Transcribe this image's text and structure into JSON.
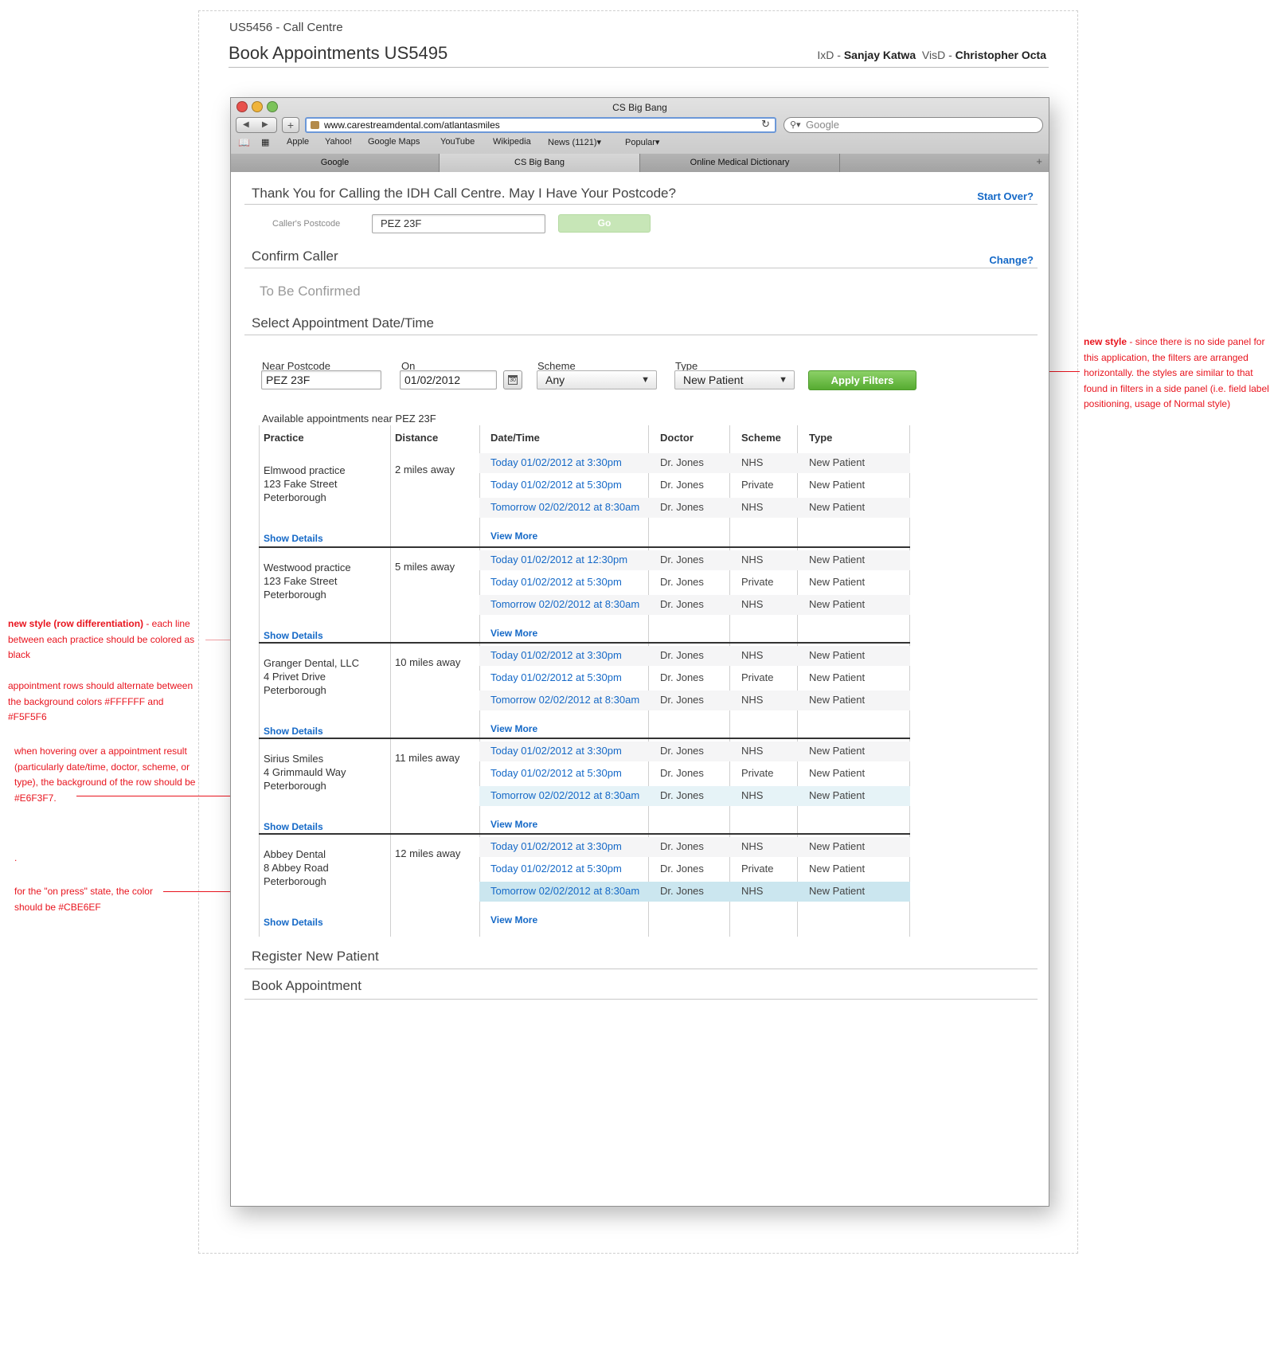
{
  "spec": {
    "project": "US5456 - Call Centre",
    "title": "Book Appointments US5495",
    "ixd_label": "IxD - ",
    "ixd_name": "Sanjay Katwa",
    "visd_label": "VisD - ",
    "visd_name": "Christopher Octa"
  },
  "notes": {
    "filters_bold": "new style",
    "filters_text": " - since there is no side panel for this application, the filters are arranged horizontally. the styles are similar to that found in filters in a side panel (i.e. field label positioning, usage of Normal style)",
    "rows_bold": "new style (row differentiation)",
    "rows_text": " - each line between each practice should be colored as black",
    "alternate_text": "appointment rows should alternate between the background colors #FFFFFF and #F5F5F6",
    "hover_text": "when hovering over a appointment result (particularly date/time, doctor, scheme, or type), the background of the row should be #E6F3F7.",
    "dot_text": ".",
    "press_text": "for the \"on press\" state, the color should be #CBE6EF"
  },
  "colors": {
    "link": "#1569c7",
    "annotation": "#e8141e",
    "row_alt": "#F5F5F6",
    "row_hover": "#E6F3F7",
    "row_press": "#CBE6EF",
    "apply_button": "#6abb43"
  },
  "browser": {
    "window_title": "CS Big Bang",
    "url": "www.carestreamdental.com/atlantasmiles",
    "search_placeholder": "Google",
    "bookmarks": [
      "Apple",
      "Yahoo!",
      "Google Maps",
      "YouTube",
      "Wikipedia",
      "News (1121)▾",
      "Popular▾"
    ],
    "tabs": [
      "Google",
      "CS Big Bang",
      "Online Medical Dictionary"
    ],
    "icons": [
      "back-arrow-icon",
      "forward-arrow-icon",
      "add-icon",
      "reload-icon",
      "search-icon",
      "bookmarks-book-icon",
      "top-sites-grid-icon",
      "new-tab-icon"
    ]
  },
  "postcode_section": {
    "title": "Thank You for Calling the IDH Call Centre. May I Have Your Postcode?",
    "start_over": "Start Over?",
    "label": "Caller's Postcode",
    "value": "PEZ 23F",
    "go": "Go"
  },
  "confirm_section": {
    "title": "Confirm Caller",
    "change": "Change?",
    "status": "To Be Confirmed"
  },
  "select_section": {
    "title": "Select Appointment Date/Time",
    "filters": {
      "near_label": "Near Postcode",
      "near_value": "PEZ 23F",
      "on_label": "On",
      "on_value": "01/02/2012",
      "scheme_label": "Scheme",
      "scheme_value": "Any",
      "type_label": "Type",
      "type_value": "New Patient",
      "apply": "Apply Filters",
      "calendar_glyph": "30"
    },
    "available": "Available appointments near PEZ 23F",
    "columns": [
      "Practice",
      "Distance",
      "Date/Time",
      "Doctor",
      "Scheme",
      "Type"
    ],
    "show_details": "Show Details",
    "view_more": "View More",
    "practices": [
      {
        "name": "Elmwood practice",
        "street": "123 Fake Street",
        "town": "Peterborough",
        "distance": "2 miles away",
        "appointments": [
          {
            "datetime": "Today 01/02/2012 at 3:30pm",
            "doctor": "Dr. Jones",
            "scheme": "NHS",
            "type": "New Patient"
          },
          {
            "datetime": "Today 01/02/2012 at 5:30pm",
            "doctor": "Dr. Jones",
            "scheme": "Private",
            "type": "New Patient"
          },
          {
            "datetime": "Tomorrow 02/02/2012 at 8:30am",
            "doctor": "Dr. Jones",
            "scheme": "NHS",
            "type": "New Patient"
          }
        ]
      },
      {
        "name": "Westwood practice",
        "street": "123 Fake Street",
        "town": "Peterborough",
        "distance": "5 miles away",
        "appointments": [
          {
            "datetime": "Today 01/02/2012 at 12:30pm",
            "doctor": "Dr. Jones",
            "scheme": "NHS",
            "type": "New Patient"
          },
          {
            "datetime": "Today 01/02/2012 at 5:30pm",
            "doctor": "Dr. Jones",
            "scheme": "Private",
            "type": "New Patient"
          },
          {
            "datetime": "Tomorrow 02/02/2012 at 8:30am",
            "doctor": "Dr. Jones",
            "scheme": "NHS",
            "type": "New Patient"
          }
        ]
      },
      {
        "name": "Granger Dental, LLC",
        "street": "4 Privet Drive",
        "town": "Peterborough",
        "distance": "10 miles away",
        "appointments": [
          {
            "datetime": "Today 01/02/2012 at 3:30pm",
            "doctor": "Dr. Jones",
            "scheme": "NHS",
            "type": "New Patient"
          },
          {
            "datetime": "Today 01/02/2012 at 5:30pm",
            "doctor": "Dr. Jones",
            "scheme": "Private",
            "type": "New Patient"
          },
          {
            "datetime": "Tomorrow 02/02/2012 at 8:30am",
            "doctor": "Dr. Jones",
            "scheme": "NHS",
            "type": "New Patient"
          }
        ]
      },
      {
        "name": "Sirius Smiles",
        "street": "4 Grimmauld Way",
        "town": "Peterborough",
        "distance": "11 miles away",
        "appointments": [
          {
            "datetime": "Today 01/02/2012 at 3:30pm",
            "doctor": "Dr. Jones",
            "scheme": "NHS",
            "type": "New Patient"
          },
          {
            "datetime": "Today 01/02/2012 at 5:30pm",
            "doctor": "Dr. Jones",
            "scheme": "Private",
            "type": "New Patient"
          },
          {
            "datetime": "Tomorrow 02/02/2012 at 8:30am",
            "doctor": "Dr. Jones",
            "scheme": "NHS",
            "type": "New Patient",
            "state": "hover"
          }
        ]
      },
      {
        "name": "Abbey Dental",
        "street": "8 Abbey Road",
        "town": "Peterborough",
        "distance": "12 miles away",
        "appointments": [
          {
            "datetime": "Today 01/02/2012 at 3:30pm",
            "doctor": "Dr. Jones",
            "scheme": "NHS",
            "type": "New Patient"
          },
          {
            "datetime": "Today 01/02/2012 at 5:30pm",
            "doctor": "Dr. Jones",
            "scheme": "Private",
            "type": "New Patient"
          },
          {
            "datetime": "Tomorrow 02/02/2012 at 8:30am",
            "doctor": "Dr. Jones",
            "scheme": "NHS",
            "type": "New Patient",
            "state": "press"
          }
        ]
      }
    ]
  },
  "register_section": {
    "title": "Register New Patient"
  },
  "book_section": {
    "title": "Book Appointment"
  }
}
